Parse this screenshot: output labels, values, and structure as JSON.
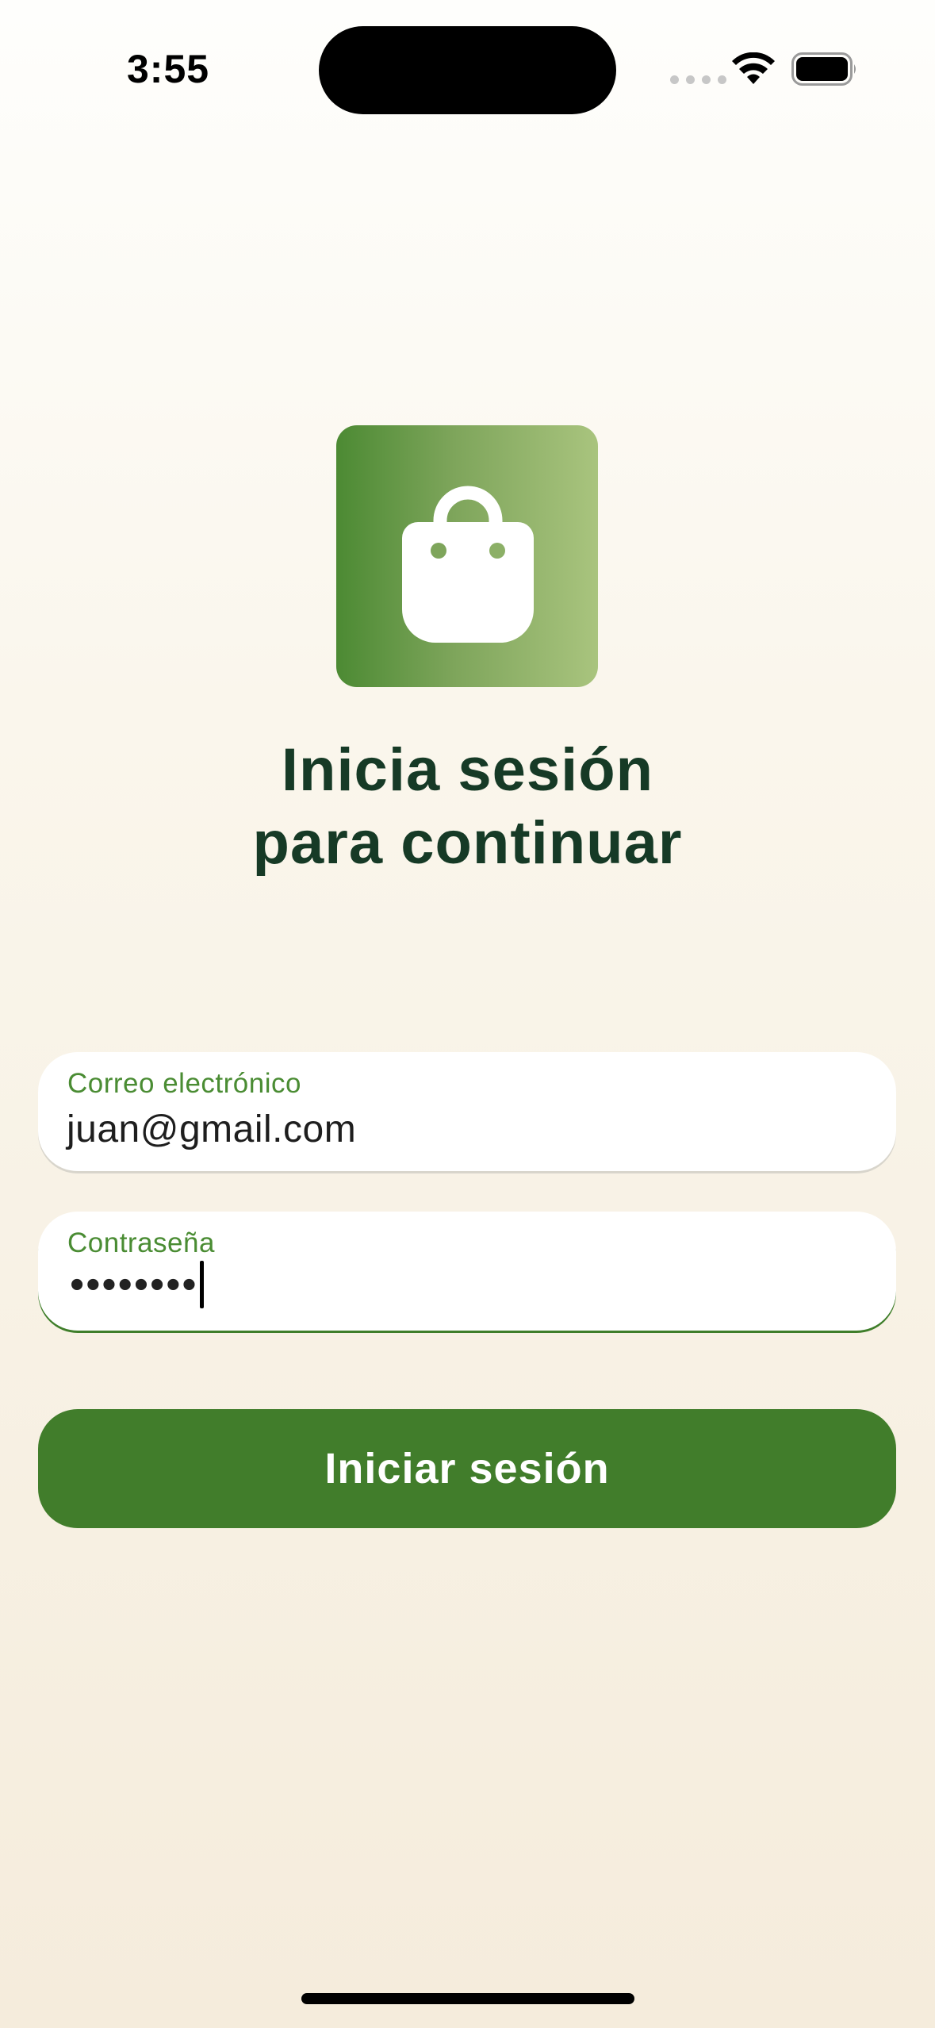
{
  "status_bar": {
    "time": "3:55",
    "icons": [
      "signal-dots-icon",
      "wifi-icon",
      "battery-icon"
    ]
  },
  "logo": {
    "icon": "shopping-bag-icon",
    "gradient": [
      "#4c8a33",
      "#a9c47e"
    ]
  },
  "heading": {
    "line1": "Inicia sesión",
    "line2": "para continuar"
  },
  "form": {
    "email": {
      "label": "Correo electrónico",
      "value": "juan@gmail.com"
    },
    "password": {
      "label": "Contraseña",
      "masked_value": "••••••••"
    },
    "submit_label": "Iniciar sesión"
  },
  "colors": {
    "accent": "#417d2b",
    "label_green": "#4a8c33",
    "heading": "#163a26"
  }
}
